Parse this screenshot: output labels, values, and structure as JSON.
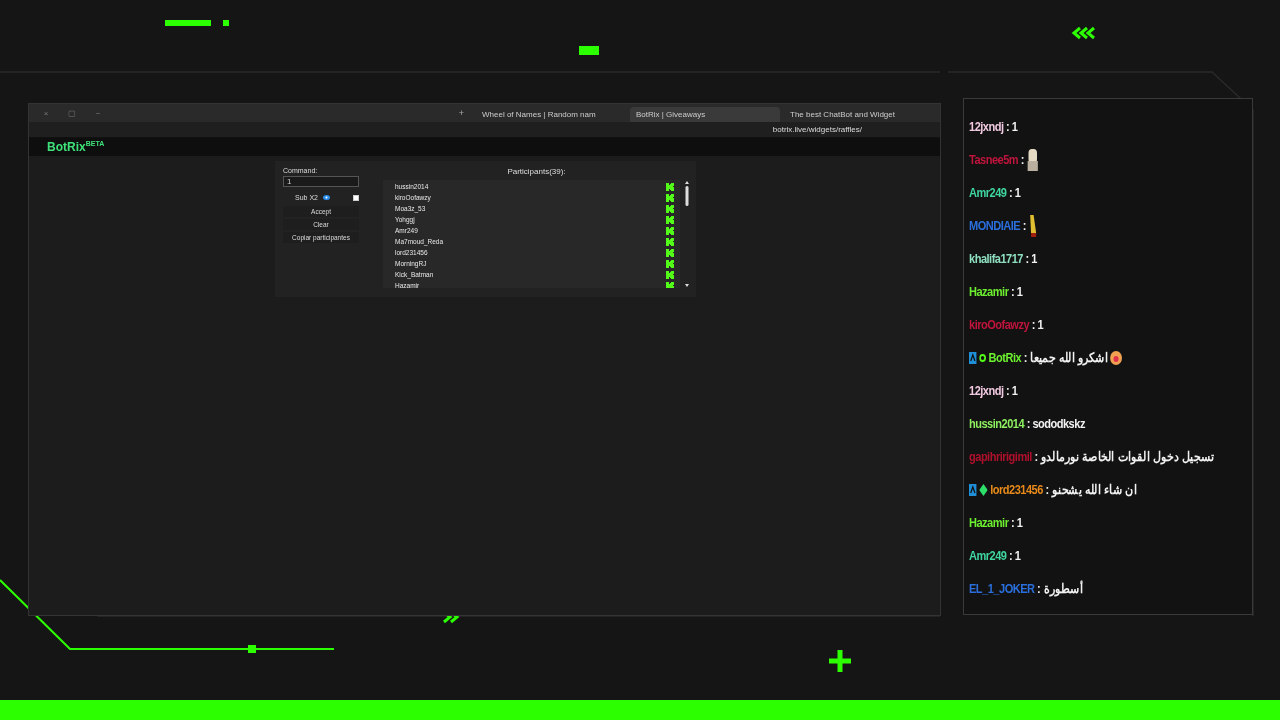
{
  "browser": {
    "window_controls": [
      "×",
      "▢",
      "−"
    ],
    "new_tab": "+",
    "tabs": [
      {
        "label": "Wheel of Names | Random nam",
        "selected": false
      },
      {
        "label": "BotRix | Giveaways",
        "selected": true
      },
      {
        "label": "The best ChatBot and Widget",
        "selected": false
      }
    ],
    "url": "botrix.live/widgets/raffles/"
  },
  "site": {
    "logo": "BotRix",
    "logo_badge": "BETA"
  },
  "raffle": {
    "command_label": "Command:",
    "command_value": "1",
    "sub_label": "Sub X2",
    "sub_checked": false,
    "buttons": [
      "Accept",
      "Clear",
      "Copiar participantes"
    ],
    "participants_title": "Participants(39):",
    "participants": [
      "hussin2014",
      "kiroOofawzy",
      "Moa3z_53",
      "Yohggj",
      "Amr249",
      "Ma7moud_Reda",
      "lord231456",
      "MorningRJ",
      "Kick_Batman",
      "Hazamir"
    ]
  },
  "chat": [
    {
      "user": "12jxndj",
      "color": "#f0c8e0",
      "text": ": 1"
    },
    {
      "user": "Tasnee5m",
      "color": "#c0143c",
      "text": ":",
      "emote": {
        "kind": "figure"
      }
    },
    {
      "user": "Amr249",
      "color": "#3fd6a0",
      "text": ": 1"
    },
    {
      "user": "MONDIAIE",
      "color": "#2a6fdc",
      "text": ":",
      "emote": {
        "kind": "bottle"
      }
    },
    {
      "user": "khalifa1717",
      "color": "#8fe0c0",
      "text": ": 1"
    },
    {
      "user": "Hazamir",
      "color": "#6cf030",
      "text": ": 1"
    },
    {
      "user": "kiroOofawzy",
      "color": "#c0143c",
      "text": ": 1"
    },
    {
      "user": "BotRix",
      "color": "#6cf030",
      "text": ": اشكرو الله جميعا",
      "emote": {
        "kind": "face"
      },
      "badges": [
        {
          "kind": "bot"
        },
        {
          "kind": "dot"
        }
      ]
    },
    {
      "user": "12jxndj",
      "color": "#f0c8e0",
      "text": ": 1"
    },
    {
      "user": "hussin2014",
      "color": "#8ef060",
      "text": ": sododkskz"
    },
    {
      "user": "gapihririgimil",
      "color": "#b0102c",
      "text": ": تسجيل دخول القوات الخاصة نورمالدو"
    },
    {
      "user": "lord231456",
      "color": "#e88a1a",
      "text": ": ان شاء الله يشحنو",
      "badges": [
        {
          "kind": "bot"
        },
        {
          "kind": "gem"
        }
      ]
    },
    {
      "user": "Hazamir",
      "color": "#6cf030",
      "text": ": 1"
    },
    {
      "user": "Amr249",
      "color": "#3fd6a0",
      "text": ": 1"
    },
    {
      "user": "EL_1_JOKER",
      "color": "#2a6fdc",
      "text": ": أسطورة"
    }
  ]
}
